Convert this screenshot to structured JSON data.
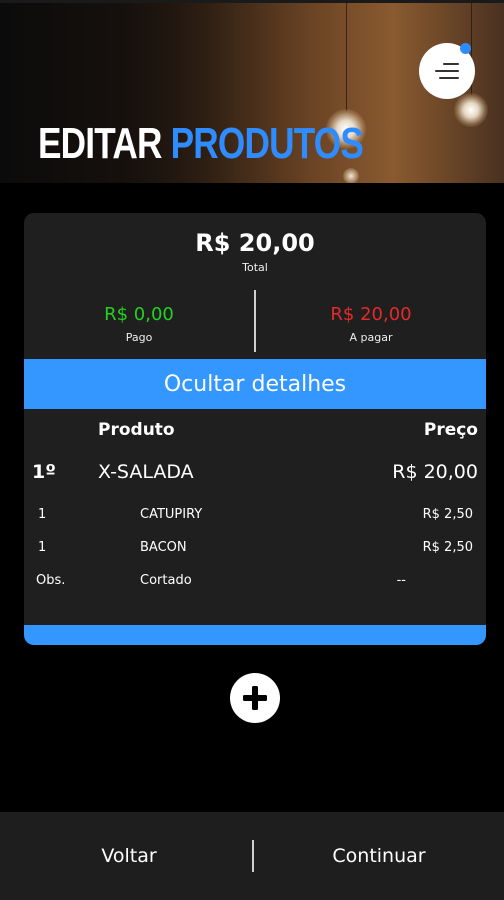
{
  "header": {
    "title_part1": "EDITAR",
    "title_part2": "PRODUTOS",
    "menu_icon": "menu-lines-icon",
    "notification_dot_color": "#2f8cff"
  },
  "summary": {
    "total_value": "R$ 20,00",
    "total_label": "Total",
    "pago_value": "R$ 0,00",
    "pago_label": "Pago",
    "apagar_value": "R$ 20,00",
    "apagar_label": "A pagar"
  },
  "details_toggle_label": "Ocultar detalhes",
  "table": {
    "col_produto": "Produto",
    "col_preco": "Preço",
    "item": {
      "index": "1º",
      "name": "X-SALADA",
      "price": "R$ 20,00"
    },
    "additions": [
      {
        "qty": "1",
        "name": "CATUPIRY",
        "price": "R$ 2,50"
      },
      {
        "qty": "1",
        "name": "BACON",
        "price": "R$ 2,50"
      }
    ],
    "obs": {
      "label": "Obs.",
      "value": "Cortado",
      "price": "--"
    }
  },
  "add_button_icon": "plus-icon",
  "footer": {
    "back_label": "Voltar",
    "continue_label": "Continuar"
  },
  "colors": {
    "accent": "#3397ff",
    "paid": "#23d21f",
    "due": "#e42a2a",
    "card_bg": "#1f1f1f"
  }
}
